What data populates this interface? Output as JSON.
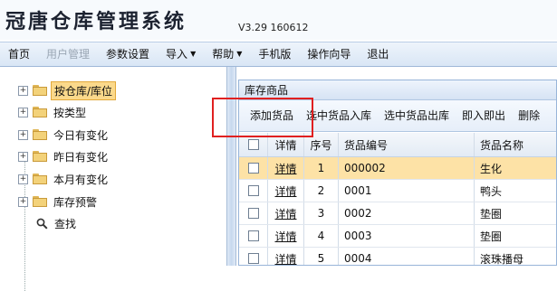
{
  "header": {
    "title": "冠唐仓库管理系统",
    "version": "V3.29 160612"
  },
  "menu": [
    {
      "label": "首页",
      "disabled": false
    },
    {
      "label": "用户管理",
      "disabled": true
    },
    {
      "label": "参数设置",
      "disabled": false
    },
    {
      "label": "导入",
      "disabled": false,
      "dropdown": true
    },
    {
      "label": "帮助",
      "disabled": false,
      "dropdown": true
    },
    {
      "label": "手机版",
      "disabled": false
    },
    {
      "label": "操作向导",
      "disabled": false
    },
    {
      "label": "退出",
      "disabled": false
    }
  ],
  "tree": {
    "items": [
      {
        "label": "按仓库/库位",
        "expander": "+",
        "icon": "folder-icon",
        "selected": true
      },
      {
        "label": "按类型",
        "expander": "+",
        "icon": "folder-icon"
      },
      {
        "label": "今日有变化",
        "expander": "+",
        "icon": "folder-icon"
      },
      {
        "label": "昨日有变化",
        "expander": "+",
        "icon": "folder-icon"
      },
      {
        "label": "本月有变化",
        "expander": "+",
        "icon": "folder-icon"
      },
      {
        "label": "库存预警",
        "expander": "+",
        "icon": "folder-icon"
      },
      {
        "label": "查找",
        "icon": "search-icon"
      }
    ]
  },
  "panel": {
    "title": "库存商品",
    "toolbar": [
      "添加货品",
      "选中货品入库",
      "选中货品出库",
      "即入即出",
      "删除"
    ],
    "columns": {
      "checkbox": "",
      "detail": "详情",
      "no": "序号",
      "code": "货品编号",
      "name": "货品名称"
    },
    "rows": [
      {
        "detail": "详情",
        "no": "1",
        "code": "000002",
        "name": "生化",
        "active": true
      },
      {
        "detail": "详情",
        "no": "2",
        "code": "0001",
        "name": "鸭头"
      },
      {
        "detail": "详情",
        "no": "3",
        "code": "0002",
        "name": "垫圈"
      },
      {
        "detail": "详情",
        "no": "4",
        "code": "0003",
        "name": "垫圈"
      },
      {
        "detail": "详情",
        "no": "5",
        "code": "0004",
        "name": "滚珠播母"
      }
    ]
  },
  "colors": {
    "accent_highlight": "#e02020",
    "selected_row": "#fde2a6",
    "selected_tree": "#fbd98b"
  }
}
